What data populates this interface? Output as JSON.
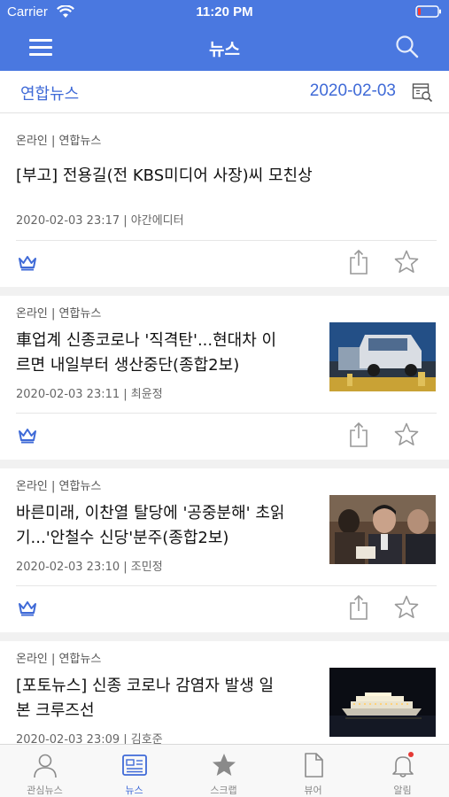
{
  "status_bar": {
    "carrier": "Carrier",
    "time": "11:20 PM"
  },
  "nav": {
    "title": "뉴스",
    "menu_icon": "menu-icon",
    "search_icon": "search-icon"
  },
  "subbar": {
    "source": "연합뉴스",
    "date": "2020-02-03",
    "calendar_icon": "calendar-search-icon"
  },
  "articles": [
    {
      "category": "온라인 | 연합뉴스",
      "title": "[부고] 전용길(전 KBS미디어 사장)씨 모친상",
      "meta": "2020-02-03 23:17 | 야간에디터",
      "has_thumbnail": false
    },
    {
      "category": "온라인 | 연합뉴스",
      "title": "車업계 신종코로나 '직격탄'...현대차 이르면 내일부터 생산중단(종합2보)",
      "title_lines": [
        "車업계 신종코로나 '직격탄'...현대차 이",
        "르면 내일부터 생산중단(종합2보)"
      ],
      "meta": "2020-02-03 23:11 | 최윤정",
      "has_thumbnail": true
    },
    {
      "category": "온라인 | 연합뉴스",
      "title": "바른미래, 이찬열 탈당에 '공중분해' 초읽기...'안철수 신당'분주(종합2보)",
      "title_lines": [
        "바른미래, 이찬열 탈당에 '공중분해' 초읽",
        "기...'안철수 신당'분주(종합2보)"
      ],
      "meta": "2020-02-03 23:10 | 조민정",
      "has_thumbnail": true
    },
    {
      "category": "온라인 | 연합뉴스",
      "title": "[포토뉴스] 신종 코로나 감염자 발생 일본 크루즈선",
      "title_lines": [
        "[포토뉴스] 신종 코로나 감염자 발생 일",
        "본 크루즈선"
      ],
      "meta": "2020-02-03 23:09 | 김호준",
      "has_thumbnail": true
    }
  ],
  "tabs": [
    {
      "label": "관심뉴스",
      "icon": "person-icon",
      "active": false
    },
    {
      "label": "뉴스",
      "icon": "newspaper-icon",
      "active": true
    },
    {
      "label": "스크랩",
      "icon": "star-icon",
      "active": false
    },
    {
      "label": "뷰어",
      "icon": "document-icon",
      "active": false
    },
    {
      "label": "알림",
      "icon": "bell-icon",
      "active": false,
      "badge": true
    }
  ],
  "colors": {
    "brand": "#4a78e0",
    "accent": "#3f6ad7",
    "badge": "#e53935"
  }
}
